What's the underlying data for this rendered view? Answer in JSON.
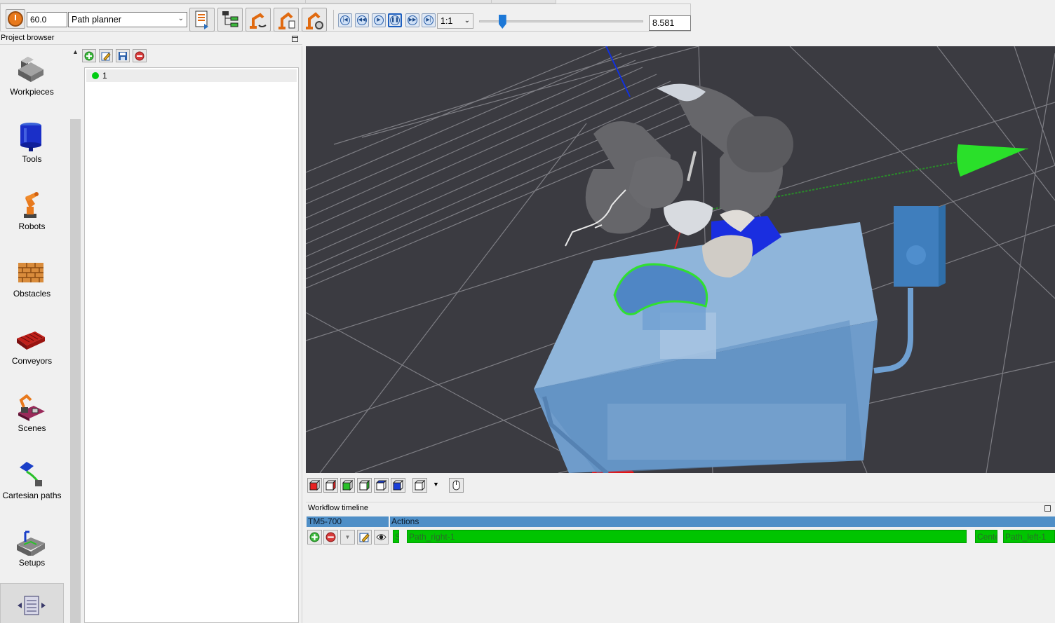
{
  "toolbar": {
    "speed_value": "60.0",
    "mode_select": "Path planner",
    "playback_ratio": "1:1",
    "timeline_position": 0.14,
    "current_time": "8.581",
    "icons": [
      "speed-dial-icon",
      "path-list-icon",
      "tree-structure-icon",
      "robot-move-icon",
      "robot-reach-icon",
      "robot-settings-icon"
    ],
    "playback_buttons": [
      "skip-to-start-icon",
      "step-back-icon",
      "play-icon",
      "pause-icon",
      "step-forward-icon",
      "skip-to-end-icon"
    ]
  },
  "project_browser": {
    "title": "Project browser",
    "items": [
      {
        "label": "Workpieces",
        "icon": "workpiece-icon"
      },
      {
        "label": "Tools",
        "icon": "tool-icon"
      },
      {
        "label": "Robots",
        "icon": "robot-icon"
      },
      {
        "label": "Obstacles",
        "icon": "brick-wall-icon"
      },
      {
        "label": "Conveyors",
        "icon": "conveyor-icon"
      },
      {
        "label": "Scenes",
        "icon": "scene-icon"
      },
      {
        "label": "Cartesian paths",
        "icon": "cartesian-path-icon"
      },
      {
        "label": "Setups",
        "icon": "setup-icon"
      },
      {
        "label": "",
        "icon": "workflow-icon"
      }
    ],
    "tree_buttons": [
      "add-icon",
      "edit-icon",
      "save-icon",
      "remove-icon"
    ],
    "tree_items": [
      {
        "label": "1",
        "status_color": "#00cc11"
      }
    ]
  },
  "viewport": {
    "background": "#3b3b41",
    "view_buttons": [
      "view-front-icon",
      "view-back-icon",
      "view-left-icon",
      "view-right-icon",
      "view-top-icon",
      "view-bottom-icon",
      "view-iso-icon",
      "mouse-mode-icon"
    ]
  },
  "workflow": {
    "title": "Workflow timeline",
    "robot_column": "TM5-700",
    "actions_column": "Actions",
    "row_buttons": [
      "add-icon",
      "remove-icon",
      "down-icon",
      "edit-icon",
      "eye-icon"
    ],
    "blocks": [
      "S",
      "Path_right-1",
      "Cente",
      "Path_left-1"
    ],
    "block_color": "#00c400"
  }
}
